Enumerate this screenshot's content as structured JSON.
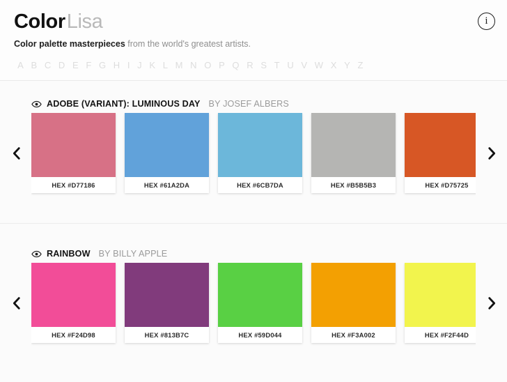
{
  "header": {
    "brand_strong": "Color",
    "brand_light": "Lisa",
    "tagline_strong": "Color palette masterpieces",
    "tagline_rest": " from the world's greatest artists.",
    "info_icon_label": "i",
    "alphabet": [
      "A",
      "B",
      "C",
      "D",
      "E",
      "F",
      "G",
      "H",
      "I",
      "J",
      "K",
      "L",
      "M",
      "N",
      "O",
      "P",
      "Q",
      "R",
      "S",
      "T",
      "U",
      "V",
      "W",
      "X",
      "Y",
      "Z"
    ]
  },
  "nav": {
    "prev_label": "‹",
    "next_label": "›"
  },
  "palettes": [
    {
      "title": "ADOBE (VARIANT): LUMINOUS DAY",
      "artist": "BY JOSEF ALBERS",
      "eye_icon": "eye-icon",
      "swatches": [
        {
          "hex": "#D77186",
          "label": "HEX #D77186"
        },
        {
          "hex": "#61A2DA",
          "label": "HEX #61A2DA"
        },
        {
          "hex": "#6CB7DA",
          "label": "HEX #6CB7DA"
        },
        {
          "hex": "#B5B5B3",
          "label": "HEX #B5B5B3"
        },
        {
          "hex": "#D75725",
          "label": "HEX #D75725"
        }
      ]
    },
    {
      "title": "RAINBOW",
      "artist": "BY BILLY APPLE",
      "eye_icon": "eye-icon",
      "swatches": [
        {
          "hex": "#F24D98",
          "label": "HEX #F24D98"
        },
        {
          "hex": "#813B7C",
          "label": "HEX #813B7C"
        },
        {
          "hex": "#59D044",
          "label": "HEX #59D044"
        },
        {
          "hex": "#F3A002",
          "label": "HEX #F3A002"
        },
        {
          "hex": "#F2F44D",
          "label": "HEX #F2F44D"
        }
      ]
    }
  ]
}
